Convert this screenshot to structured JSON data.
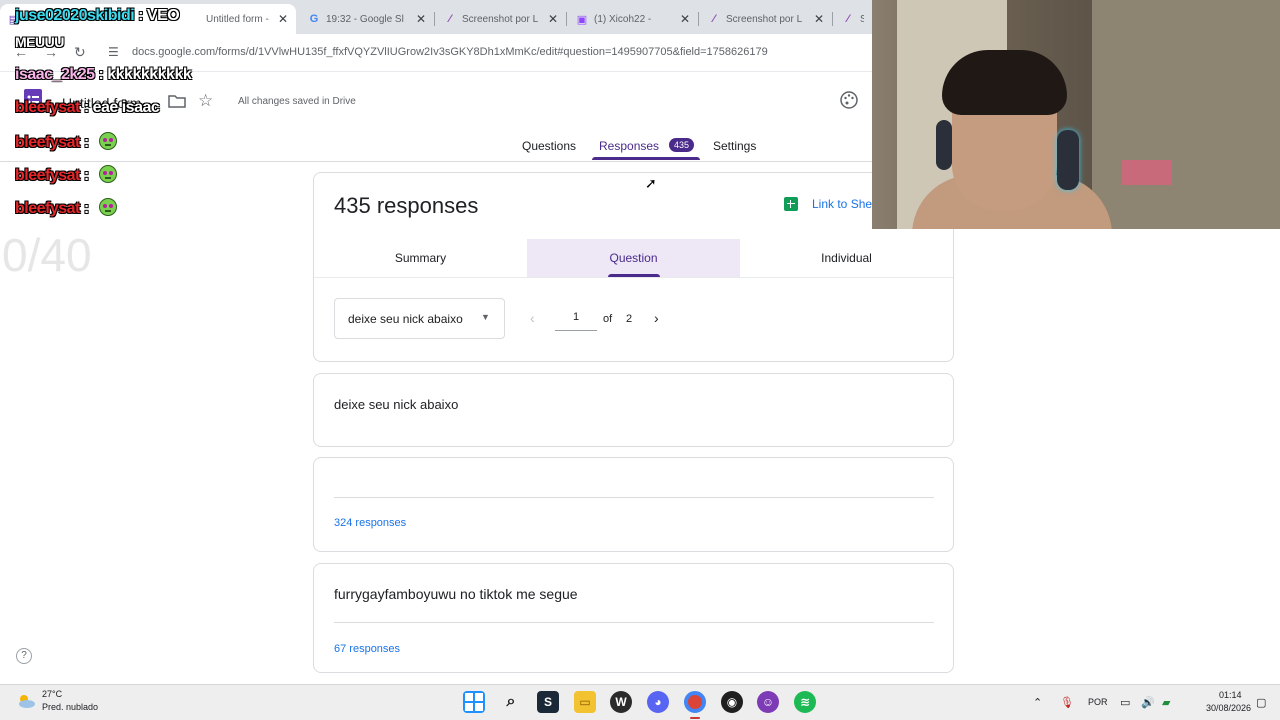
{
  "browser": {
    "tabs": [
      {
        "title": "Untitled form - G",
        "active": true
      },
      {
        "title": "19:32 - Google Sl",
        "active": false
      },
      {
        "title": "Screenshot por L",
        "active": false
      },
      {
        "title": "(1) Xicoh22 - ",
        "active": false
      },
      {
        "title": "Screenshot por L",
        "active": false
      },
      {
        "title": "Sc",
        "active": false
      }
    ],
    "url": "docs.google.com/forms/d/1VVlwHU135f_ffxfVQYZVlIUGrow2Iv3sGKY8Dh1xMmKc/edit#question=1495907705&field=1758626179"
  },
  "forms": {
    "title": "Untitled form",
    "save_status": "All changes saved in Drive",
    "tabs": {
      "questions": "Questions",
      "responses": "Responses",
      "responses_count": "435",
      "settings": "Settings"
    }
  },
  "responses_card": {
    "total": "435 responses",
    "link_sheets": "Link to Sheets",
    "subtabs": {
      "summary": "Summary",
      "question": "Question",
      "individual": "Individual"
    },
    "question_select": "deixe seu nick abaixo",
    "pager": {
      "current": "1",
      "of": "of",
      "total": "2"
    }
  },
  "question_card": {
    "title": "deixe seu nick abaixo"
  },
  "answers": [
    {
      "text": "",
      "count": "324 responses"
    },
    {
      "text": "furrygayfamboyuwu no tiktok me segue",
      "count": "67 responses"
    }
  ],
  "chat": [
    {
      "user": "juse02020skibidi",
      "sep": " : ",
      "message": "VEO",
      "color": "#3cdcf0"
    },
    {
      "user": "",
      "sep": "",
      "message": "MEUUU",
      "color": "#ffffff"
    },
    {
      "user": "isaac_2k25",
      "sep": " : ",
      "message": "kkkkkkkkkk",
      "color": "#f7b3e8"
    },
    {
      "user": "bleefysat",
      "sep": " : ",
      "message": "eae isaac",
      "color": "#e8262a"
    },
    {
      "user": "bleefysat",
      "sep": " : ",
      "message": "",
      "color": "#e8262a"
    },
    {
      "user": "bleefysat",
      "sep": " : ",
      "message": "",
      "color": "#e8262a"
    },
    {
      "user": "bleefysat",
      "sep": " : ",
      "message": "",
      "color": "#e8262a"
    }
  ],
  "goal_counter": "0/40",
  "taskbar": {
    "weather_temp": "27°C",
    "weather_desc": "Pred. nublado",
    "language": "POR",
    "time": "01:14",
    "date": "30/08/2026"
  },
  "colors": {
    "forms_purple": "#4a2a8a",
    "link_blue": "#1a73e8",
    "sheets_green": "#0f9d58"
  }
}
